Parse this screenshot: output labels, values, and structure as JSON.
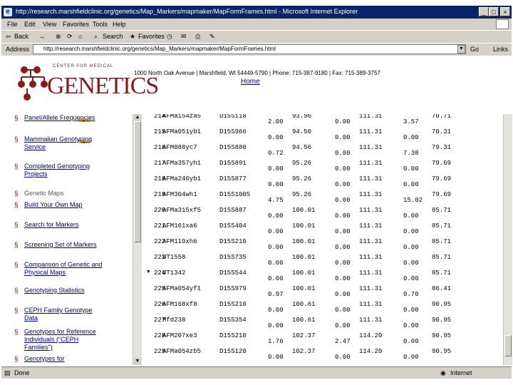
{
  "window": {
    "title": "http://research.marshfieldclinic.org/genetics/Map_Markers/mapmaker/MapFormFrames.html - Microsoft Internet Explorer",
    "buttons": {
      "minimize": "_",
      "maximize": "□",
      "close": "×"
    }
  },
  "menu": {
    "items": [
      "File",
      "Edit",
      "View",
      "Favorites",
      "Tools",
      "Help"
    ]
  },
  "toolbar": {
    "back": "Back",
    "forward": "→",
    "search": "Search",
    "favorites": "Favorites"
  },
  "address": {
    "label": "Address",
    "url": "http://research.marshfieldclinic.org/genetics/Map_Markers/mapmaker/MapFormFrames.html",
    "go": "Go",
    "links": "Links"
  },
  "header": {
    "logo_top": "CENTER FOR MEDICAL",
    "logo_main": "GENETICS",
    "address": "1000 North Oak Avenue | Marshfield, WI 54449-5790 | Phone: 715-387-9180 | Fax: 715-389-3757",
    "home": "Home"
  },
  "sidebar": {
    "items": [
      {
        "label": "Panel/Allele Frequencies",
        "new": "NEW"
      },
      {
        "label": "Mammalian Genotyping Service",
        "new": "NEW"
      },
      {
        "label": "Completed Genotyping Projects",
        "new": ""
      },
      {
        "label": "Genetic Maps",
        "new": ""
      },
      {
        "label": "Build Your Own Map",
        "new": ""
      },
      {
        "label": "Search for Markers",
        "new": ""
      },
      {
        "label": "Screening Set of Markers",
        "new": ""
      },
      {
        "label": "Comparison of Genetic and Physical Maps",
        "new": ""
      },
      {
        "label": "Genotyping Statistics",
        "new": ""
      },
      {
        "label": "CEPH Family Genotype Data",
        "new": ""
      },
      {
        "label": "Genotypes for Reference Individuals (\"CEPH Families\")",
        "new": ""
      },
      {
        "label": "Genotypes for",
        "new": ""
      }
    ]
  },
  "table": {
    "rows": [
      {
        "num": "214",
        "marker": "AFMa154za5",
        "id": "D15S118",
        "a": "2.00",
        "b": "93.96",
        "c": "0.00",
        "d": "111.31",
        "e": "3.57",
        "f": "70.71"
      },
      {
        "num": "215",
        "marker": "AFMa051yb1",
        "id": "D15S966",
        "a": "0.00",
        "b": "94.50",
        "c": "0.00",
        "d": "111.31",
        "e": "0.00",
        "f": "70.31"
      },
      {
        "num": "216",
        "marker": "AFM088yc7",
        "id": "D15S880",
        "a": "0.72",
        "b": "94.56",
        "c": "0.00",
        "d": "111.31",
        "e": "7.38",
        "f": "79.31"
      },
      {
        "num": "217",
        "marker": "AFMa357yh1",
        "id": "D15S891",
        "a": "0.00",
        "b": "95.26",
        "c": "0.00",
        "d": "111.31",
        "e": "0.00",
        "f": "79.69"
      },
      {
        "num": "218",
        "marker": "AFMa246yb1",
        "id": "D15S877",
        "a": "0.00",
        "b": "95.26",
        "c": "0.00",
        "d": "111.31",
        "e": "0.00",
        "f": "79.69"
      },
      {
        "num": "219",
        "marker": "AFM304wh1",
        "id": "D15S1005",
        "a": "4.75",
        "b": "95.26",
        "c": "0.00",
        "d": "111.31",
        "e": "15.02",
        "f": "79.69"
      },
      {
        "num": "220",
        "marker": "AFMa315xf5",
        "id": "D15S887",
        "a": "0.00",
        "b": "100.01",
        "c": "0.00",
        "d": "111.31",
        "e": "0.00",
        "f": "85.71"
      },
      {
        "num": "221",
        "marker": "AFM161xa6",
        "id": "D15S404",
        "a": "0.00",
        "b": "100.01",
        "c": "0.00",
        "d": "111.31",
        "e": "0.00",
        "f": "85.71"
      },
      {
        "num": "222",
        "marker": "AFM119xh6",
        "id": "D15S210",
        "a": "0.00",
        "b": "100.01",
        "c": "0.00",
        "d": "111.31",
        "e": "0.00",
        "f": "85.71"
      },
      {
        "num": "223",
        "marker": "UT1558",
        "id": "D15S735",
        "a": "0.00",
        "b": "100.01",
        "c": "0.00",
        "d": "111.31",
        "e": "0.00",
        "f": "85.71"
      },
      {
        "num": "224",
        "marker": "UT1342",
        "id": "D15S544",
        "a": "0.00",
        "b": "100.01",
        "c": "0.00",
        "d": "111.31",
        "e": "0.00",
        "f": "85.71"
      },
      {
        "num": "225",
        "marker": "AFMa054yf1",
        "id": "D15S979",
        "a": "0.97",
        "b": "100.01",
        "c": "0.00",
        "d": "111.31",
        "e": "0.70",
        "f": "86.41"
      },
      {
        "num": "226",
        "marker": "AFM168xf8",
        "id": "D15S210",
        "a": "0.00",
        "b": "100.61",
        "c": "0.00",
        "d": "111.31",
        "e": "0.00",
        "f": "90.95"
      },
      {
        "num": "227",
        "marker": "Mfd238",
        "id": "D15S354",
        "a": "0.00",
        "b": "100.61",
        "c": "0.00",
        "d": "111.31",
        "e": "0.00",
        "f": "90.95"
      },
      {
        "num": "228",
        "marker": "AFM207xe3",
        "id": "D15S210",
        "a": "1.76",
        "b": "102.37",
        "c": "2.47",
        "d": "114.20",
        "e": "0.00",
        "f": "90.95"
      },
      {
        "num": "229",
        "marker": "AFMa054zb5",
        "id": "D15S120",
        "a": "0.00",
        "b": "102.37",
        "c": "0.00",
        "d": "114.20",
        "e": "0.00",
        "f": "90.95"
      }
    ],
    "selected_marker": "▼"
  },
  "status": {
    "left": "Done",
    "zone": "Internet"
  }
}
